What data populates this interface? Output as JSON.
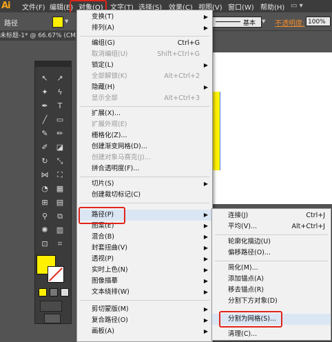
{
  "logo": "Ai",
  "menubar": [
    "文件(F)",
    "编辑(E)",
    "对象(O)",
    "文字(T)",
    "选择(S)",
    "效果(C)",
    "视图(V)",
    "窗口(W)",
    "帮助(H)"
  ],
  "controlbar": {
    "path_label": "路径",
    "stroke_style": "基本",
    "opacity_label": "不透明度:",
    "opacity_value": "100%"
  },
  "document_tab": "未标题-1* @ 66.67% (CM",
  "object_menu": [
    {
      "label": "变换(T)",
      "shortcut": "",
      "submenu": true,
      "disabled": false
    },
    {
      "label": "排列(A)",
      "shortcut": "",
      "submenu": true,
      "disabled": false
    },
    {
      "label": "编组(G)",
      "shortcut": "Ctrl+G",
      "submenu": false,
      "disabled": false
    },
    {
      "label": "取消编组(U)",
      "shortcut": "Shift+Ctrl+G",
      "submenu": false,
      "disabled": true
    },
    {
      "label": "锁定(L)",
      "shortcut": "",
      "submenu": true,
      "disabled": false
    },
    {
      "label": "全部解锁(K)",
      "shortcut": "Alt+Ctrl+2",
      "submenu": false,
      "disabled": true
    },
    {
      "label": "隐藏(H)",
      "shortcut": "",
      "submenu": true,
      "disabled": false
    },
    {
      "label": "显示全部",
      "shortcut": "Alt+Ctrl+3",
      "submenu": false,
      "disabled": true
    },
    {
      "label": "扩展(X)...",
      "shortcut": "",
      "submenu": false,
      "disabled": false
    },
    {
      "label": "扩展外观(E)",
      "shortcut": "",
      "submenu": false,
      "disabled": true
    },
    {
      "label": "栅格化(Z)...",
      "shortcut": "",
      "submenu": false,
      "disabled": false
    },
    {
      "label": "创建渐变网格(D)...",
      "shortcut": "",
      "submenu": false,
      "disabled": false
    },
    {
      "label": "创建对象马赛克(J)...",
      "shortcut": "",
      "submenu": false,
      "disabled": true
    },
    {
      "label": "拼合透明度(F)...",
      "shortcut": "",
      "submenu": false,
      "disabled": false
    },
    {
      "label": "切片(S)",
      "shortcut": "",
      "submenu": true,
      "disabled": false
    },
    {
      "label": "创建裁切标记(C)",
      "shortcut": "",
      "submenu": false,
      "disabled": false
    },
    {
      "label": "路径(P)",
      "shortcut": "",
      "submenu": true,
      "disabled": false
    },
    {
      "label": "图案(E)",
      "shortcut": "",
      "submenu": true,
      "disabled": false
    },
    {
      "label": "混合(B)",
      "shortcut": "",
      "submenu": true,
      "disabled": false
    },
    {
      "label": "封套扭曲(V)",
      "shortcut": "",
      "submenu": true,
      "disabled": false
    },
    {
      "label": "透视(P)",
      "shortcut": "",
      "submenu": true,
      "disabled": false
    },
    {
      "label": "实时上色(N)",
      "shortcut": "",
      "submenu": true,
      "disabled": false
    },
    {
      "label": "图像描摹",
      "shortcut": "",
      "submenu": true,
      "disabled": false
    },
    {
      "label": "文本绕排(W)",
      "shortcut": "",
      "submenu": true,
      "disabled": false
    },
    {
      "label": "剪切蒙版(M)",
      "shortcut": "",
      "submenu": true,
      "disabled": false
    },
    {
      "label": "复合路径(O)",
      "shortcut": "",
      "submenu": true,
      "disabled": false
    },
    {
      "label": "画板(A)",
      "shortcut": "",
      "submenu": true,
      "disabled": false
    }
  ],
  "path_submenu": [
    {
      "label": "连接(J)",
      "shortcut": "Ctrl+J"
    },
    {
      "label": "平均(V)...",
      "shortcut": "Alt+Ctrl+J"
    },
    {
      "label": "轮廓化描边(U)",
      "shortcut": ""
    },
    {
      "label": "偏移路径(O)...",
      "shortcut": ""
    },
    {
      "label": "简化(M)...",
      "shortcut": ""
    },
    {
      "label": "添加锚点(A)",
      "shortcut": ""
    },
    {
      "label": "移去锚点(R)",
      "shortcut": ""
    },
    {
      "label": "分割下方对象(D)",
      "shortcut": ""
    },
    {
      "label": "分割为网格(S)...",
      "shortcut": ""
    },
    {
      "label": "清理(C)...",
      "shortcut": ""
    }
  ],
  "colors": {
    "fill": "#ffef00",
    "highlight_box": "#e0251b",
    "accent": "#f7a21b"
  }
}
